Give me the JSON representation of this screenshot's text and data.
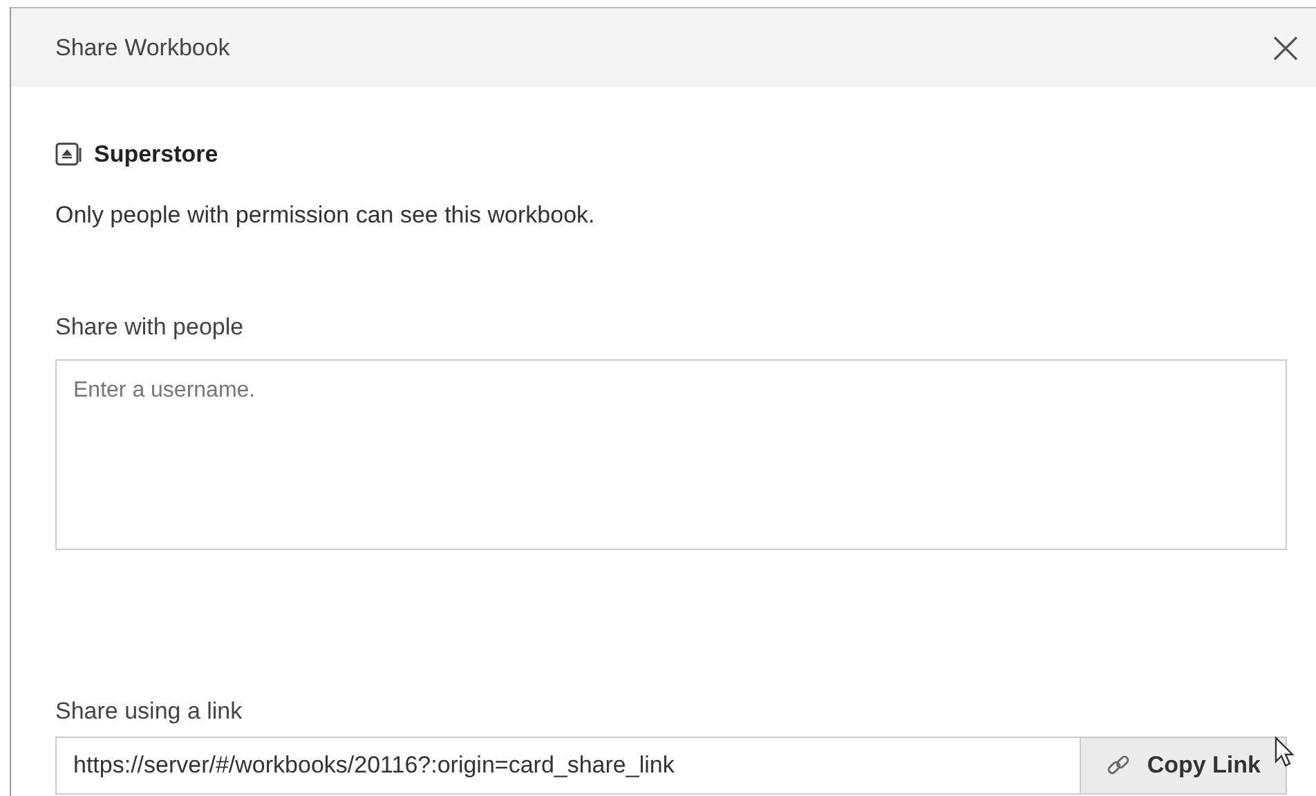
{
  "dialog": {
    "title": "Share Workbook"
  },
  "workbook": {
    "name": "Superstore"
  },
  "description": "Only people with permission can see this workbook.",
  "share_with_people": {
    "label": "Share with people",
    "placeholder": "Enter a username."
  },
  "share_link": {
    "label": "Share using a link",
    "value": "https://server/#/workbooks/20116?:origin=card_share_link",
    "button": "Copy Link"
  }
}
